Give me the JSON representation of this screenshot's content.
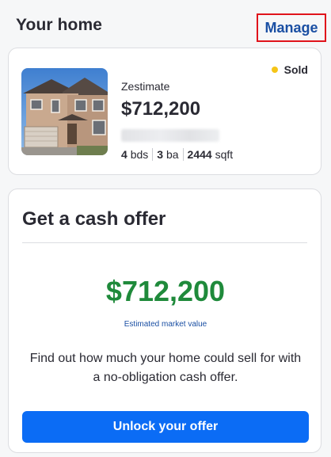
{
  "header": {
    "title": "Your home",
    "manage_label": "Manage"
  },
  "home_card": {
    "status": "Sold",
    "status_color": "#f5c518",
    "zestimate_label": "Zestimate",
    "zestimate_value": "$712,200",
    "facts": {
      "beds_value": "4",
      "beds_unit": "bds",
      "baths_value": "3",
      "baths_unit": "ba",
      "sqft_value": "2444",
      "sqft_unit": "sqft"
    }
  },
  "cash_offer": {
    "title": "Get a cash offer",
    "value": "$712,200",
    "value_color": "#1f8a3b",
    "value_caption": "Estimated market value",
    "description": "Find out how much your home could sell for with a no-obligation cash offer.",
    "button_label": "Unlock your offer",
    "button_color": "#0b6cf5"
  }
}
